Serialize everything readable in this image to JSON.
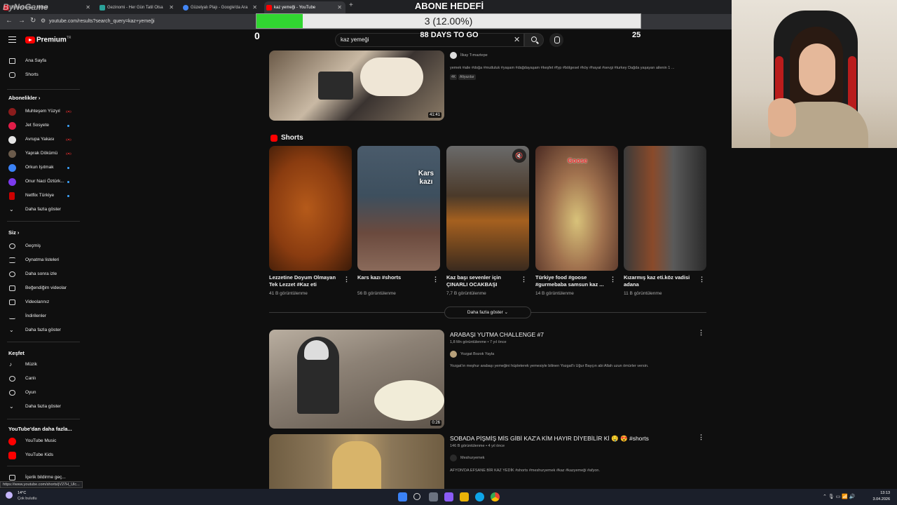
{
  "browser": {
    "tabs": [
      {
        "label": "ByNoGame - Milbot",
        "color": "#c1121f"
      },
      {
        "label": "Gezinomi - Her Gün Tatil Olsa",
        "color": "#2aa198"
      },
      {
        "label": "Güzelyalı Plajı - Google'da Ara",
        "color": "#4285f4"
      },
      {
        "label": "kaz yemeği - YouTube",
        "color": "#ff0000"
      }
    ],
    "url": "youtube.com/results?search_query=kaz+yemeği",
    "status_url": "https://www.youtube.com/shorts/jV27H_Ulc..."
  },
  "overlay": {
    "title": "ABONE HEDEFİ",
    "progress_text": "3 (12.00%)",
    "progress_fraction": 0.12,
    "days_left": "88 DAYS TO GO",
    "min": "0",
    "max": "25",
    "watermark": "ByNoGame"
  },
  "header": {
    "brand": "Premium",
    "brand_sup": "TR",
    "search_value": "kaz yemeği",
    "clear_icon": "✕"
  },
  "sidebar": {
    "main": [
      {
        "label": "Ana Sayfa",
        "icon": "home-icon"
      },
      {
        "label": "Shorts",
        "icon": "shorts-icon"
      }
    ],
    "subs_head": "Abonelikler",
    "subs": [
      {
        "label": "Muhteşem Yüzyıl",
        "color": "#8b1c1c",
        "status": "live"
      },
      {
        "label": "Jet Sosyete",
        "color": "#e11d48",
        "status": "dot"
      },
      {
        "label": "Avrupa Yakası",
        "color": "#e5e5e5",
        "status": "live"
      },
      {
        "label": "Yaprak Dökümü",
        "color": "#6b5b4b",
        "status": "live"
      },
      {
        "label": "Orkun Işıtmak",
        "color": "#3b82f6",
        "status": "dot"
      },
      {
        "label": "Onur Naci Öztürk...",
        "color": "#7c3aed",
        "status": "dot"
      },
      {
        "label": "Netflix Türkiye",
        "color": "#c00",
        "status": "dot"
      }
    ],
    "more": "Daha fazla göster",
    "you_head": "Siz",
    "you": [
      {
        "label": "Geçmiş",
        "icon": "history-icon"
      },
      {
        "label": "Oynatma listeleri",
        "icon": "playlist-icon"
      },
      {
        "label": "Daha sonra izle",
        "icon": "clock-icon"
      },
      {
        "label": "Beğendiğim videolar",
        "icon": "like-icon"
      },
      {
        "label": "Videolarınız",
        "icon": "video-icon"
      },
      {
        "label": "İndirilenler",
        "icon": "download-icon"
      },
      {
        "label": "Daha fazla göster",
        "icon": "chevron-down-icon"
      }
    ],
    "explore_head": "Keşfet",
    "explore": [
      {
        "label": "Müzik",
        "icon": "music-icon"
      },
      {
        "label": "Canlı",
        "icon": "live-icon"
      },
      {
        "label": "Oyun",
        "icon": "game-icon"
      },
      {
        "label": "Daha fazla göster",
        "icon": "chevron-down-icon"
      }
    ],
    "more_yt_head": "YouTube'dan daha fazla...",
    "more_yt": [
      {
        "label": "YouTube Music",
        "icon": "yt-music-icon"
      },
      {
        "label": "YouTube Kids",
        "icon": "yt-kids-icon"
      }
    ],
    "report": "İçerik bildirme geç..."
  },
  "video1": {
    "channel": "İlkay Tımaztepe",
    "desc": "yemek #aile #doğa #mutluluk #yaşam #dağdayaşam #keşfet #fyp #bölgesel #köy #hayat #sevgi #turkey Dağda yaşayan ailenin 1 ...",
    "badges": [
      "4K",
      "Altyazılar"
    ],
    "duration": "41:41"
  },
  "shorts": {
    "label": "Shorts",
    "items": [
      {
        "title": "Lezzetine Doyum Olmayan Tek Lezzet #Kaz eti",
        "views": "41 B görüntülenme",
        "overlay": ""
      },
      {
        "title": "Kars kazı #shorts",
        "views": "56 B görüntülenme",
        "overlay": "Kars kazı"
      },
      {
        "title": "Kaz başı sevenler için ÇINARLI OCAKBAŞI",
        "views": "7,7 B görüntülenme",
        "overlay": ""
      },
      {
        "title": "Türkiye food #goose #gurmebaba samsun kaz ...",
        "views": "14 B görüntülenme",
        "overlay": "Goose"
      },
      {
        "title": "Kızarmış kaz eti.köz vadisi adana",
        "views": "11 B görüntülenme",
        "overlay": ""
      }
    ],
    "more_label": "Daha fazla göster"
  },
  "video2": {
    "title": "ARABAŞI YUTMA CHALLENGE #7",
    "meta": "1,8 Mn görüntülenme • 7 yıl önce",
    "channel": "Yozgat Bozok Yayla",
    "desc": "Yozgat'ın meşhur arabaşı yemeğini hüpleterek yemesiyle bilinen Yozgat'lı Uğur Bayçın abi Allah uzun ömürler versin.",
    "duration": "0:26"
  },
  "video3": {
    "title": "SOBADA PİŞMİŞ MİS GİBİ KAZ'A KİM HAYIR DİYEBİLİR Kİ 🤤 😍 #shorts",
    "meta": "146 B görüntülenme • 4 yıl önce",
    "channel": "Meshuryemek",
    "desc": "AFYON'DA EFSANE BİR KAZ YEDİK #shorts #meshuryemek #kaz #kazyemeği #afyon."
  },
  "taskbar": {
    "weather_temp": "14°C",
    "weather_text": "Çok bulutlu",
    "time": "13:13",
    "date": "3.04.2026"
  }
}
